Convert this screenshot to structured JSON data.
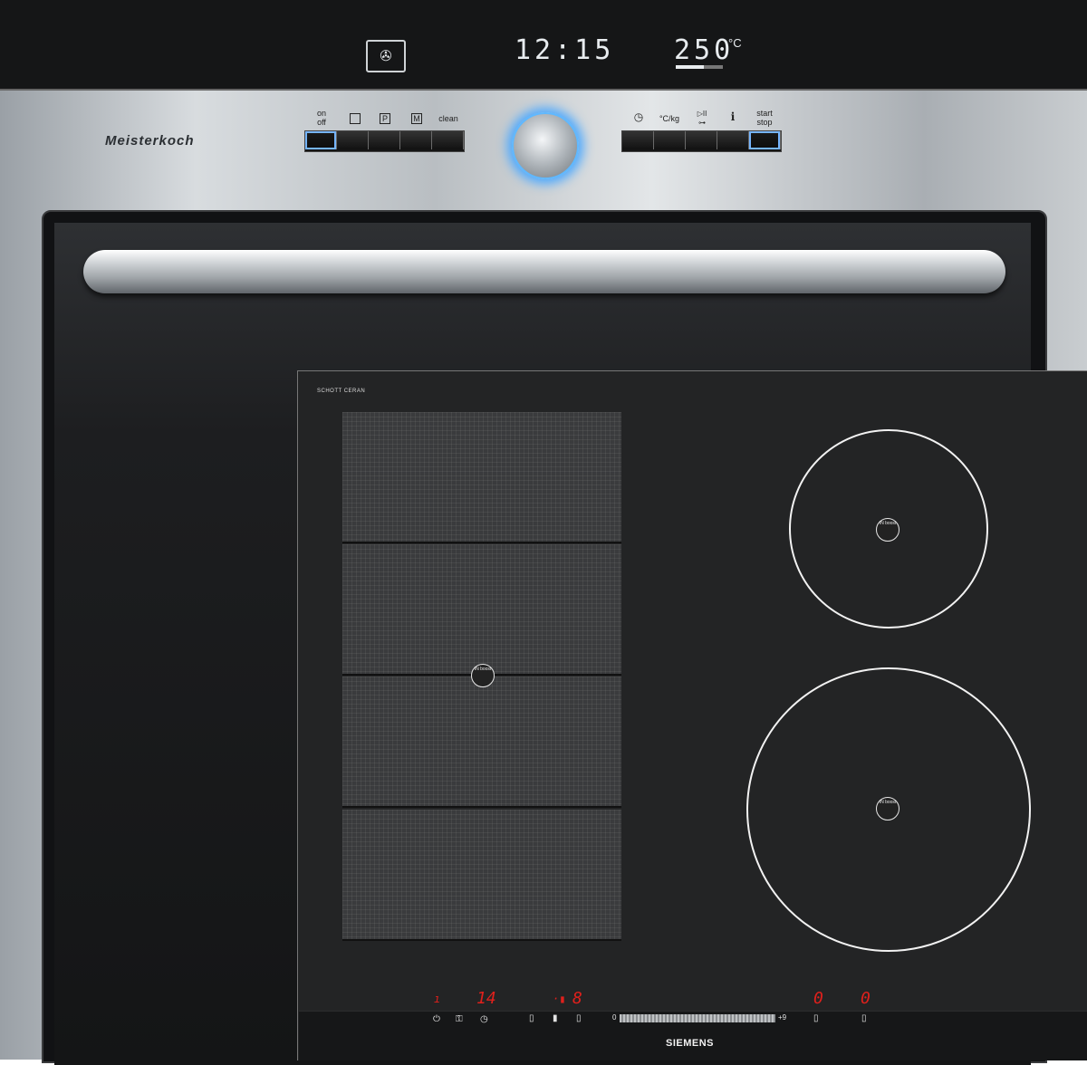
{
  "oven": {
    "display": {
      "mode_icon": "fan-icon",
      "time": "12:15",
      "temperature": "250",
      "temperature_unit": "°C"
    },
    "brand": "Meisterkoch",
    "left_buttons": [
      {
        "label_line1": "on",
        "label_line2": "off"
      },
      {
        "icon": "square-icon"
      },
      {
        "label": "P"
      },
      {
        "label": "M"
      },
      {
        "label": "clean"
      }
    ],
    "right_buttons": [
      {
        "icon": "clock-icon"
      },
      {
        "label": "°C/kg"
      },
      {
        "icon": "play-pause-lock-icon"
      },
      {
        "label": "i"
      },
      {
        "label_line1": "start",
        "label_line2": "stop"
      }
    ]
  },
  "cooktop": {
    "logo": "SCHOTT CERAN",
    "zone_badge": "IN boost",
    "display_left": "14",
    "display_mid": "8",
    "display_right1": "0",
    "display_right2": "0",
    "brand": "SIEMENS",
    "controls": {
      "power": "power-icon",
      "child_lock": "child-lock-icon",
      "timer": "timer-icon",
      "zone_select_icons": [
        "zone-select-icon",
        "zone-select-icon",
        "zone-select-icon"
      ],
      "slider_min": "0",
      "slider_max": "+9",
      "front_right": "zone-select-icon",
      "rear_right": "zone-select-icon"
    },
    "colors": {
      "display": "#e0201c",
      "glow": "#4aa8ff"
    }
  }
}
